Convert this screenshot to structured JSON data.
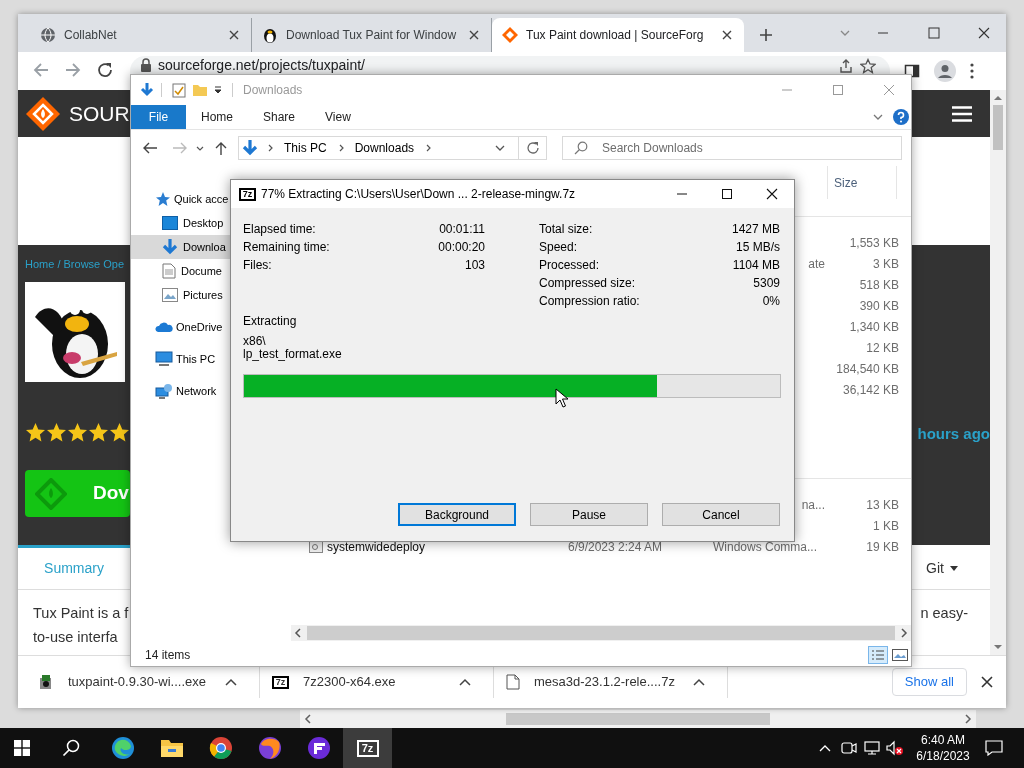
{
  "browser": {
    "tabs": [
      {
        "title": "CollabNet",
        "selected": false
      },
      {
        "title": "Download Tux Paint for Window",
        "selected": false
      },
      {
        "title": "Tux Paint download | SourceForg",
        "selected": true
      }
    ],
    "url": "sourceforge.net/projects/tuxpaint/"
  },
  "web_page": {
    "logo_text": "SOUR",
    "breadcrumb": "Home / Browse Ope",
    "stars": 5,
    "download_button": "Dov",
    "updated": "hours ago",
    "tabs": [
      {
        "label": "Summary",
        "selected": true,
        "dropdown": false
      },
      {
        "label": "Git",
        "selected": false,
        "dropdown": true
      }
    ],
    "description": [
      "Tux Paint is a f",
      "to-use interfa"
    ],
    "description_cut": "n easy-"
  },
  "downloads_shelf": {
    "items": [
      {
        "kind": "installer",
        "file": "tuxpaint-0.9.30-wi....exe"
      },
      {
        "kind": "archive",
        "icon_text": "7z",
        "file": "7z2300-x64.exe"
      },
      {
        "kind": "file",
        "file": "mesa3d-23.1.2-rele....7z"
      }
    ],
    "show_all": "Show all"
  },
  "explorer": {
    "title": "Downloads",
    "ribbon_tabs": [
      {
        "label": "File",
        "selected": true
      },
      {
        "label": "Home",
        "selected": false
      },
      {
        "label": "Share",
        "selected": false
      },
      {
        "label": "View",
        "selected": false
      }
    ],
    "path": [
      "This PC",
      "Downloads"
    ],
    "search_placeholder": "Search Downloads",
    "nav": [
      {
        "label": "Quick acce",
        "selected": false,
        "children": [
          {
            "label": "Desktop",
            "selected": false
          },
          {
            "label": "Downloa",
            "selected": true
          },
          {
            "label": "Docume",
            "selected": false
          },
          {
            "label": "Pictures",
            "selected": false
          }
        ]
      },
      {
        "label": "OneDrive",
        "selected": false
      },
      {
        "label": "This PC",
        "selected": false
      },
      {
        "label": "Network",
        "selected": false
      }
    ],
    "size_header": "Size",
    "groups": [
      {
        "rows": [
          {
            "size": "1,553 KB"
          },
          {
            "type": "ate",
            "size": "3 KB"
          },
          {
            "size": "518 KB"
          },
          {
            "size": "390 KB"
          },
          {
            "size": "1,340 KB"
          },
          {
            "size": "12 KB"
          },
          {
            "size": "184,540 KB"
          },
          {
            "size": "36,142 KB"
          }
        ]
      },
      {
        "rows": [
          {
            "type": "na...",
            "size": "13 KB"
          },
          {
            "size": "1 KB"
          },
          {
            "name": "systemwidedeploy",
            "date": "6/9/2023 2:24 AM",
            "type": "Windows Comma...",
            "size": "19 KB"
          }
        ]
      }
    ],
    "status": "14 items"
  },
  "extract_dialog": {
    "icon_text": "7z",
    "title": "77% Extracting C:\\Users\\User\\Down ... 2-release-mingw.7z",
    "left_stats": [
      {
        "label": "Elapsed time:",
        "value": "00:01:11"
      },
      {
        "label": "Remaining time:",
        "value": "00:00:20"
      },
      {
        "label": "Files:",
        "value": "103"
      }
    ],
    "right_stats": [
      {
        "label": "Total size:",
        "value": "1427 MB"
      },
      {
        "label": "Speed:",
        "value": "15 MB/s"
      },
      {
        "label": "Processed:",
        "value": "1104 MB"
      },
      {
        "label": "Compressed size:",
        "value": "5309"
      },
      {
        "label": "Compression ratio:",
        "value": "0%"
      }
    ],
    "status": "Extracting",
    "path_lines": [
      "x86\\",
      "lp_test_format.exe"
    ],
    "level": 0.77,
    "buttons": [
      {
        "label": "Background",
        "focused": true
      },
      {
        "label": "Pause",
        "focused": false
      },
      {
        "label": "Cancel",
        "focused": false
      }
    ]
  },
  "taskbar": {
    "apps": [
      {
        "active": false
      },
      {
        "active": false
      },
      {
        "active": false
      },
      {
        "active": false
      },
      {
        "active": false
      },
      {
        "icon_text": "7z",
        "active": true
      }
    ],
    "time": "6:40 AM",
    "date": "6/18/2023"
  }
}
